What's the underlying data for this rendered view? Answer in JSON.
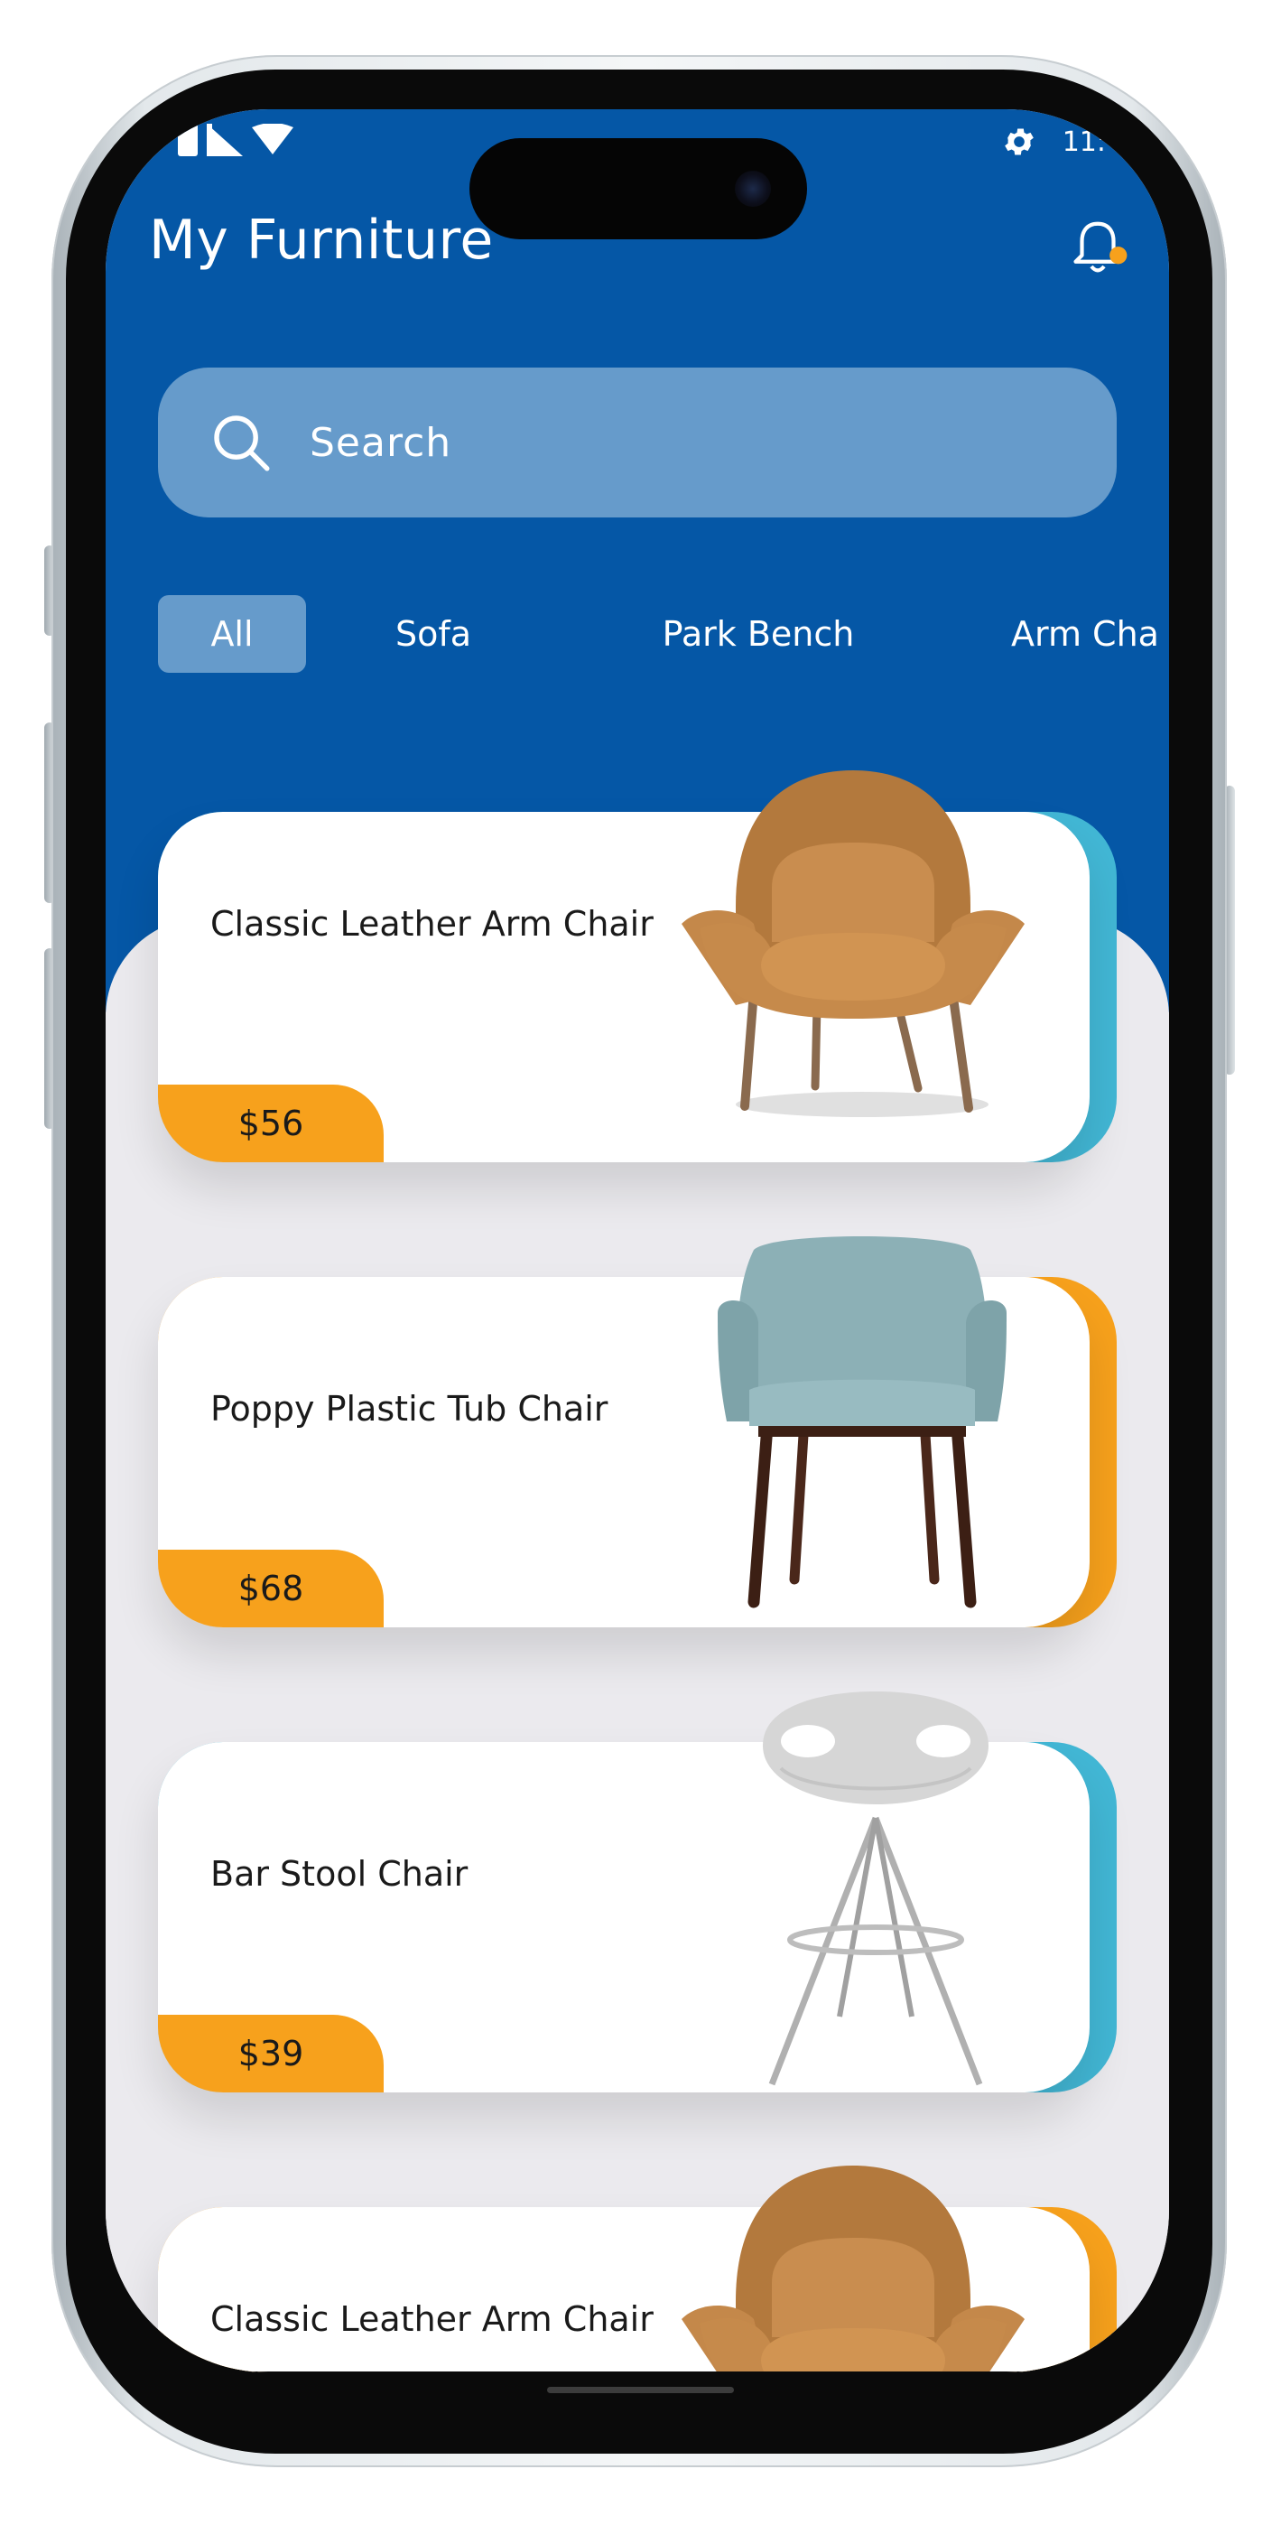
{
  "app": {
    "title": "My Furniture",
    "status_time": "11:"
  },
  "search": {
    "placeholder": "Search"
  },
  "tabs": [
    {
      "label": "All",
      "active": true
    },
    {
      "label": "Sofa",
      "active": false
    },
    {
      "label": "Park Bench",
      "active": false
    },
    {
      "label": "Arm Cha",
      "active": false
    }
  ],
  "products": [
    {
      "name": "Classic Leather Arm Chair",
      "price": "$56",
      "accent": "#42b7d5",
      "icon": "armchair-tan"
    },
    {
      "name": "Poppy Plastic Tub Chair",
      "price": "$68",
      "accent": "#f7a11c",
      "icon": "tub-chair-blue"
    },
    {
      "name": "Bar Stool Chair",
      "price": "$39",
      "accent": "#42b7d5",
      "icon": "bar-stool"
    },
    {
      "name": "Classic Leather Arm Chair",
      "price": "",
      "accent": "#f7a11c",
      "icon": "armchair-tan"
    }
  ],
  "colors": {
    "header": "#0557a6",
    "chip": "#669bcb",
    "price_tag": "#f7a11c",
    "cyan_accent": "#42b7d5",
    "background": "#ebeaee"
  }
}
